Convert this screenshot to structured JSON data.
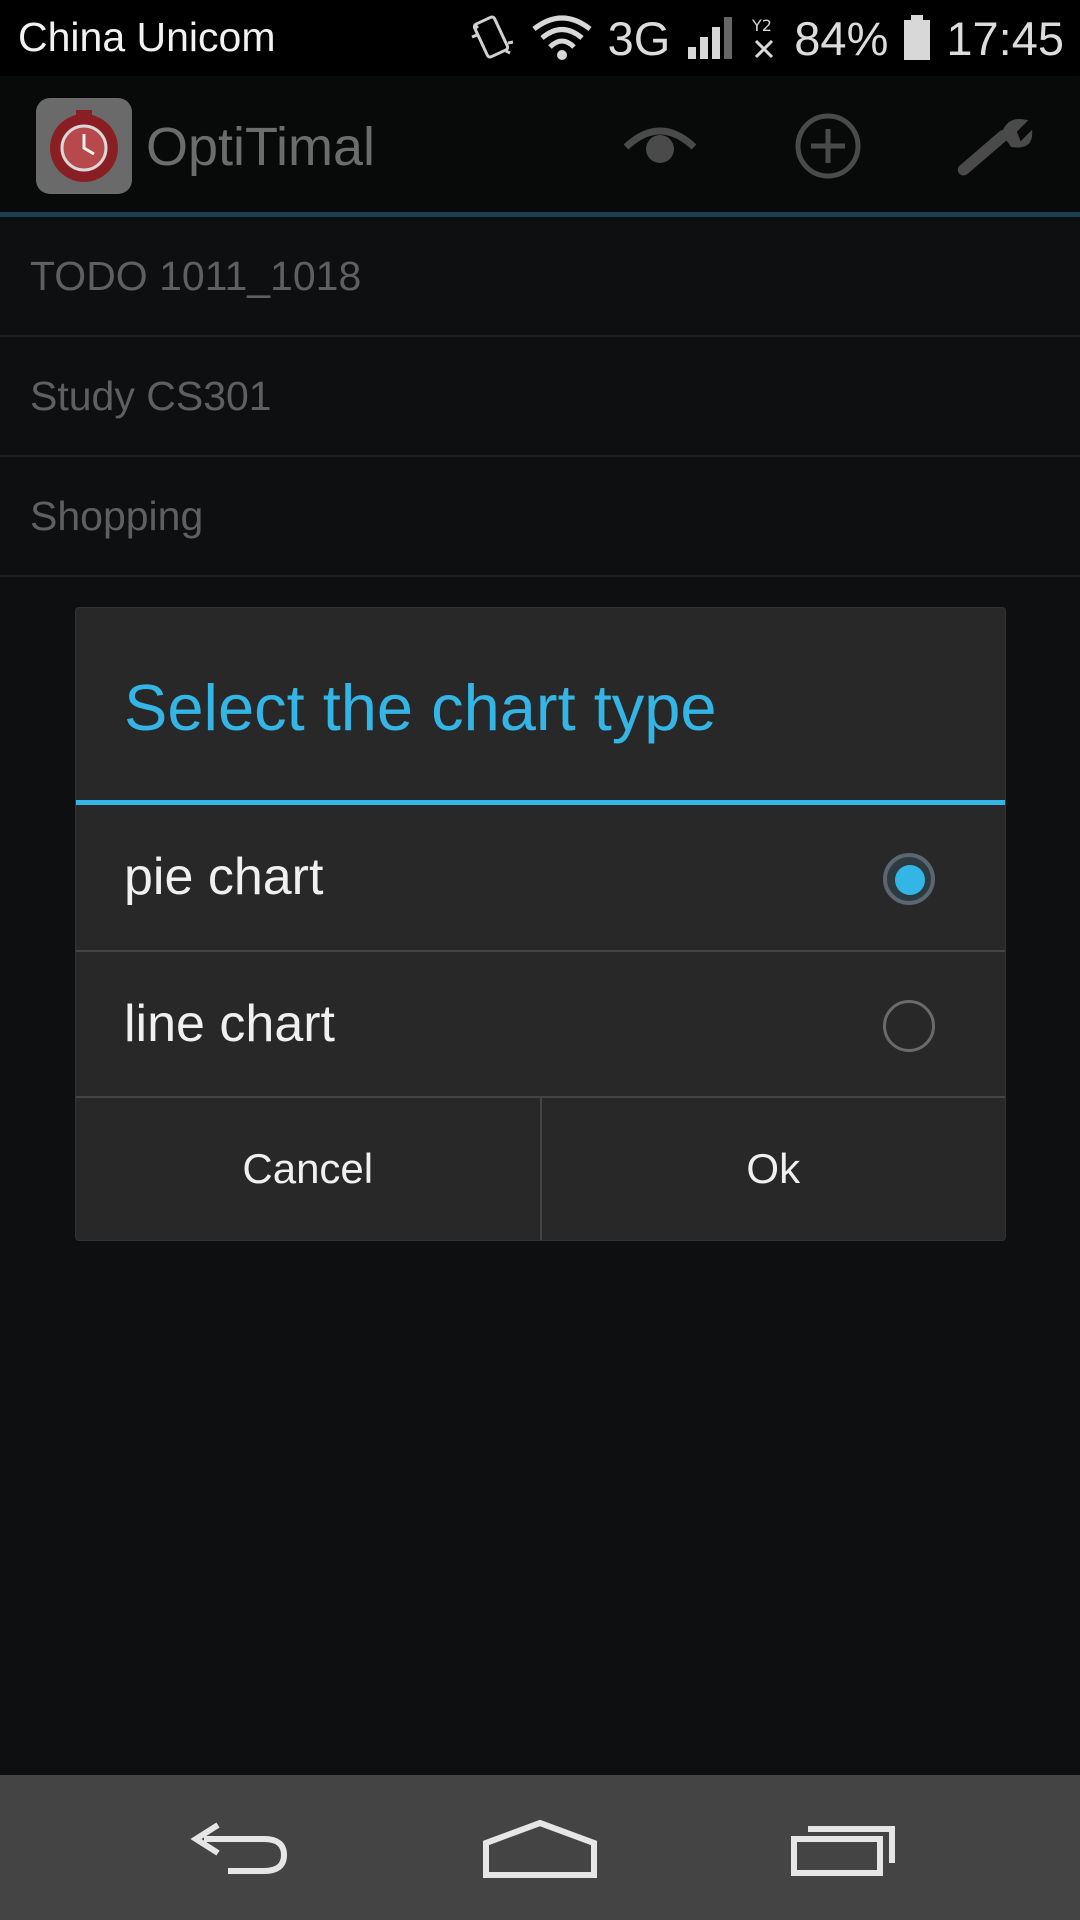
{
  "status_bar": {
    "carrier": "China Unicom",
    "network": "3G",
    "battery": "84%",
    "time": "17:45",
    "icons": [
      "vibrate-icon",
      "wifi-icon",
      "signal-icon",
      "no-signal-icon",
      "battery-icon"
    ]
  },
  "app_bar": {
    "title": "OptiTimal",
    "actions": [
      "eye-icon",
      "add-circle-icon",
      "wrench-icon"
    ]
  },
  "list": {
    "items": [
      "TODO 1011_1018",
      "Study CS301",
      "Shopping"
    ]
  },
  "dialog": {
    "title": "Select the chart type",
    "options": [
      {
        "label": "pie chart",
        "selected": true
      },
      {
        "label": "line chart",
        "selected": false
      }
    ],
    "cancel_label": "Cancel",
    "ok_label": "Ok"
  },
  "nav_bar": {
    "buttons": [
      "back-icon",
      "home-icon",
      "recents-icon"
    ]
  },
  "colors": {
    "accent": "#33b5e5",
    "dialog_bg": "#282828",
    "navbar_bg": "#444444"
  }
}
